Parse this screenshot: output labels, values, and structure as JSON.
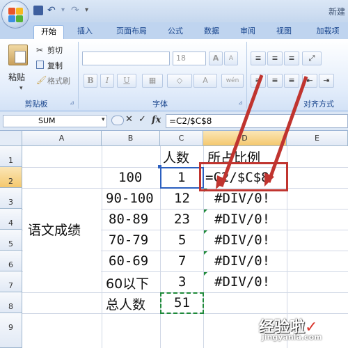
{
  "window": {
    "title": "新建"
  },
  "tabs": [
    "开始",
    "插入",
    "页面布局",
    "公式",
    "数据",
    "审阅",
    "视图",
    "加载项"
  ],
  "ribbon": {
    "clipboard": {
      "paste": "粘贴",
      "cut": "剪切",
      "copy": "复制",
      "format_painter": "格式刷",
      "group_label": "剪贴板"
    },
    "font": {
      "font_size": "18",
      "grow": "A",
      "shrink": "A",
      "bold": "B",
      "italic": "I",
      "underline": "U",
      "font_color": "A",
      "phonetic": "wén",
      "group_label": "字体"
    },
    "alignment": {
      "group_label": "对齐方式"
    }
  },
  "formula_bar": {
    "name_box": "SUM",
    "fx": "fx",
    "formula": "=C2/$C$8"
  },
  "columns": [
    "A",
    "B",
    "C",
    "D",
    "E"
  ],
  "rows": [
    "1",
    "2",
    "3",
    "4",
    "5",
    "6",
    "7",
    "8",
    "9"
  ],
  "cells": {
    "C1": "人数",
    "D1": "所占比例",
    "B2": "100",
    "C2": "1",
    "D2": "=C2/$C$8",
    "A3": "语文成绩",
    "B3": "90-100",
    "C3": "12",
    "D3": "#DIV/0!",
    "B4": "80-89",
    "C4": "23",
    "D4": "#DIV/0!",
    "B5": "70-79",
    "C5": "5",
    "D5": "#DIV/0!",
    "B6": "60-69",
    "C6": "7",
    "D6": "#DIV/0!",
    "B7": "60以下",
    "C7": "3",
    "D7": "#DIV/0!",
    "B8": "总人数",
    "C8": "51"
  },
  "watermark": {
    "text": "经验啦",
    "check": "✓",
    "url": "jingyanla.com"
  },
  "colors": {
    "accent": "#15428b",
    "selection": "#2b5fbf",
    "green_border": "#1f8a3a",
    "callout": "#c0342f"
  }
}
